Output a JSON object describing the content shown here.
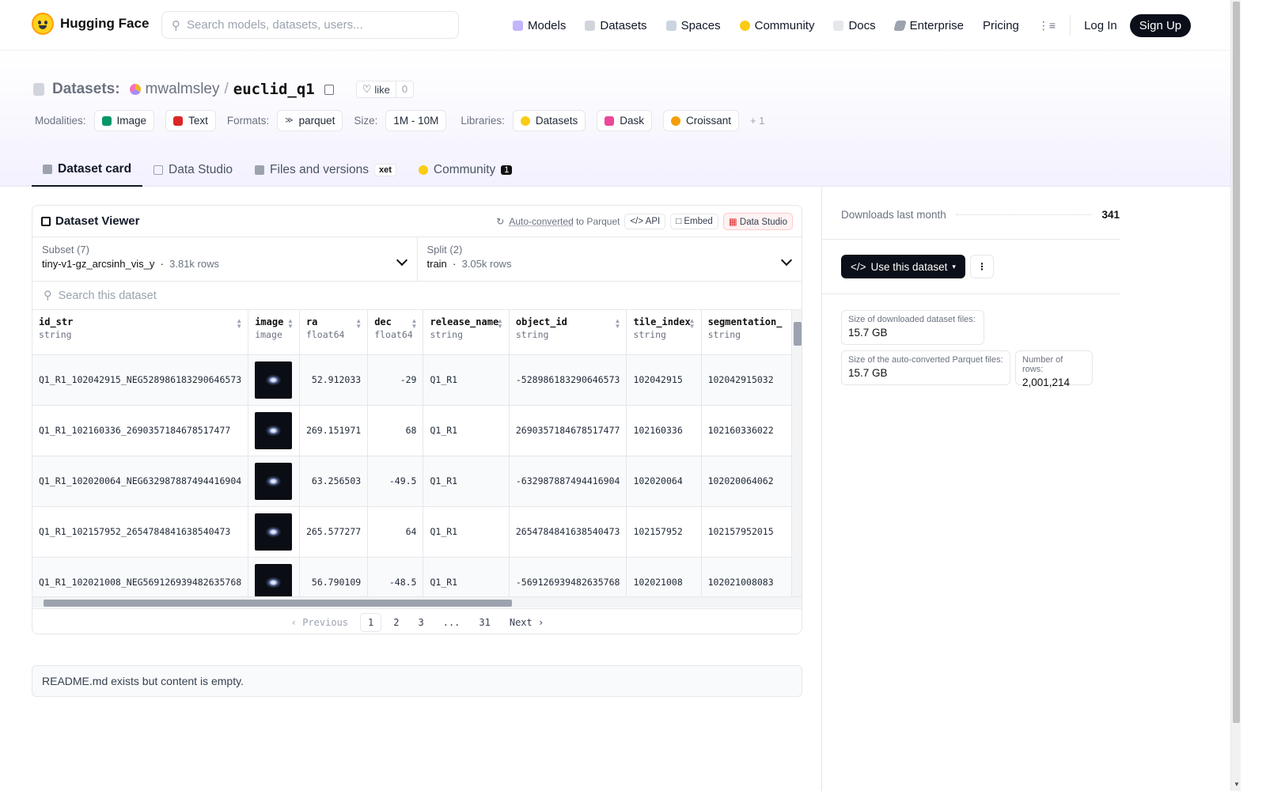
{
  "nav": {
    "brand": "Hugging Face",
    "search_placeholder": "Search models, datasets, users...",
    "links": [
      "Models",
      "Datasets",
      "Spaces",
      "Community",
      "Docs",
      "Enterprise",
      "Pricing"
    ],
    "login": "Log In",
    "signup": "Sign Up"
  },
  "header": {
    "section": "Datasets:",
    "owner": "mwalmsley",
    "separator": "/",
    "name": "euclid_q1",
    "like_label": "like",
    "like_count": "0",
    "modalities_label": "Modalities:",
    "modalities": [
      "Image",
      "Text"
    ],
    "formats_label": "Formats:",
    "format": "parquet",
    "size_label": "Size:",
    "size": "1M - 10M",
    "libraries_label": "Libraries:",
    "libraries": [
      "Datasets",
      "Dask",
      "Croissant"
    ],
    "libraries_more": "+ 1"
  },
  "tabs": {
    "card": "Dataset card",
    "studio": "Data Studio",
    "files": "Files and versions",
    "xet": "xet",
    "community": "Community",
    "community_count": "1"
  },
  "viewer": {
    "title": "Dataset Viewer",
    "auto_converted": "Auto-converted",
    "to_parquet": "to Parquet",
    "api": "API",
    "embed": "Embed",
    "studio": "Data Studio",
    "subset_label": "Subset (7)",
    "subset_value": "tiny-v1-gz_arcsinh_vis_y",
    "subset_rows": "3.81k rows",
    "split_label": "Split (2)",
    "split_value": "train",
    "split_rows": "3.05k rows",
    "search_placeholder": "Search this dataset",
    "columns": [
      {
        "name": "id_str",
        "type": "string"
      },
      {
        "name": "image",
        "type": "image"
      },
      {
        "name": "ra",
        "type": "float64"
      },
      {
        "name": "dec",
        "type": "float64"
      },
      {
        "name": "release_name",
        "type": "string"
      },
      {
        "name": "object_id",
        "type": "string"
      },
      {
        "name": "tile_index",
        "type": "string"
      },
      {
        "name": "segmentation_",
        "type": "string"
      }
    ],
    "rows": [
      {
        "id_str": "Q1_R1_102042915_NEG528986183290646573",
        "ra": "52.912033",
        "dec": "-29",
        "release": "Q1_R1",
        "object_id": "-528986183290646573",
        "tile": "102042915",
        "seg": "102042915032"
      },
      {
        "id_str": "Q1_R1_102160336_2690357184678517477",
        "ra": "269.151971",
        "dec": "68",
        "release": "Q1_R1",
        "object_id": "2690357184678517477",
        "tile": "102160336",
        "seg": "102160336022"
      },
      {
        "id_str": "Q1_R1_102020064_NEG632987887494416904",
        "ra": "63.256503",
        "dec": "-49.5",
        "release": "Q1_R1",
        "object_id": "-632987887494416904",
        "tile": "102020064",
        "seg": "102020064062"
      },
      {
        "id_str": "Q1_R1_102157952_2654784841638540473",
        "ra": "265.577277",
        "dec": "64",
        "release": "Q1_R1",
        "object_id": "2654784841638540473",
        "tile": "102157952",
        "seg": "102157952015"
      },
      {
        "id_str": "Q1_R1_102021008_NEG569126939482635768",
        "ra": "56.790109",
        "dec": "-48.5",
        "release": "Q1_R1",
        "object_id": "-569126939482635768",
        "tile": "102021008",
        "seg": "102021008083"
      }
    ],
    "pager": {
      "prev": "Previous",
      "pages": [
        "1",
        "2",
        "3",
        "...",
        "31"
      ],
      "next": "Next",
      "current": "1"
    }
  },
  "readme": "README.md exists but content is empty.",
  "sidebar": {
    "downloads_label": "Downloads last month",
    "downloads_value": "341",
    "use_button": "Use this dataset",
    "size_dl_label": "Size of downloaded dataset files:",
    "size_dl_value": "15.7 GB",
    "size_pq_label": "Size of the auto-converted Parquet files:",
    "size_pq_value": "15.7 GB",
    "rows_label": "Number of rows:",
    "rows_value": "2,001,214"
  },
  "colors": {
    "accent_dark": "#0b0f19",
    "gradient": "#f3f1fe",
    "hf_yellow": "#ffd21e"
  }
}
